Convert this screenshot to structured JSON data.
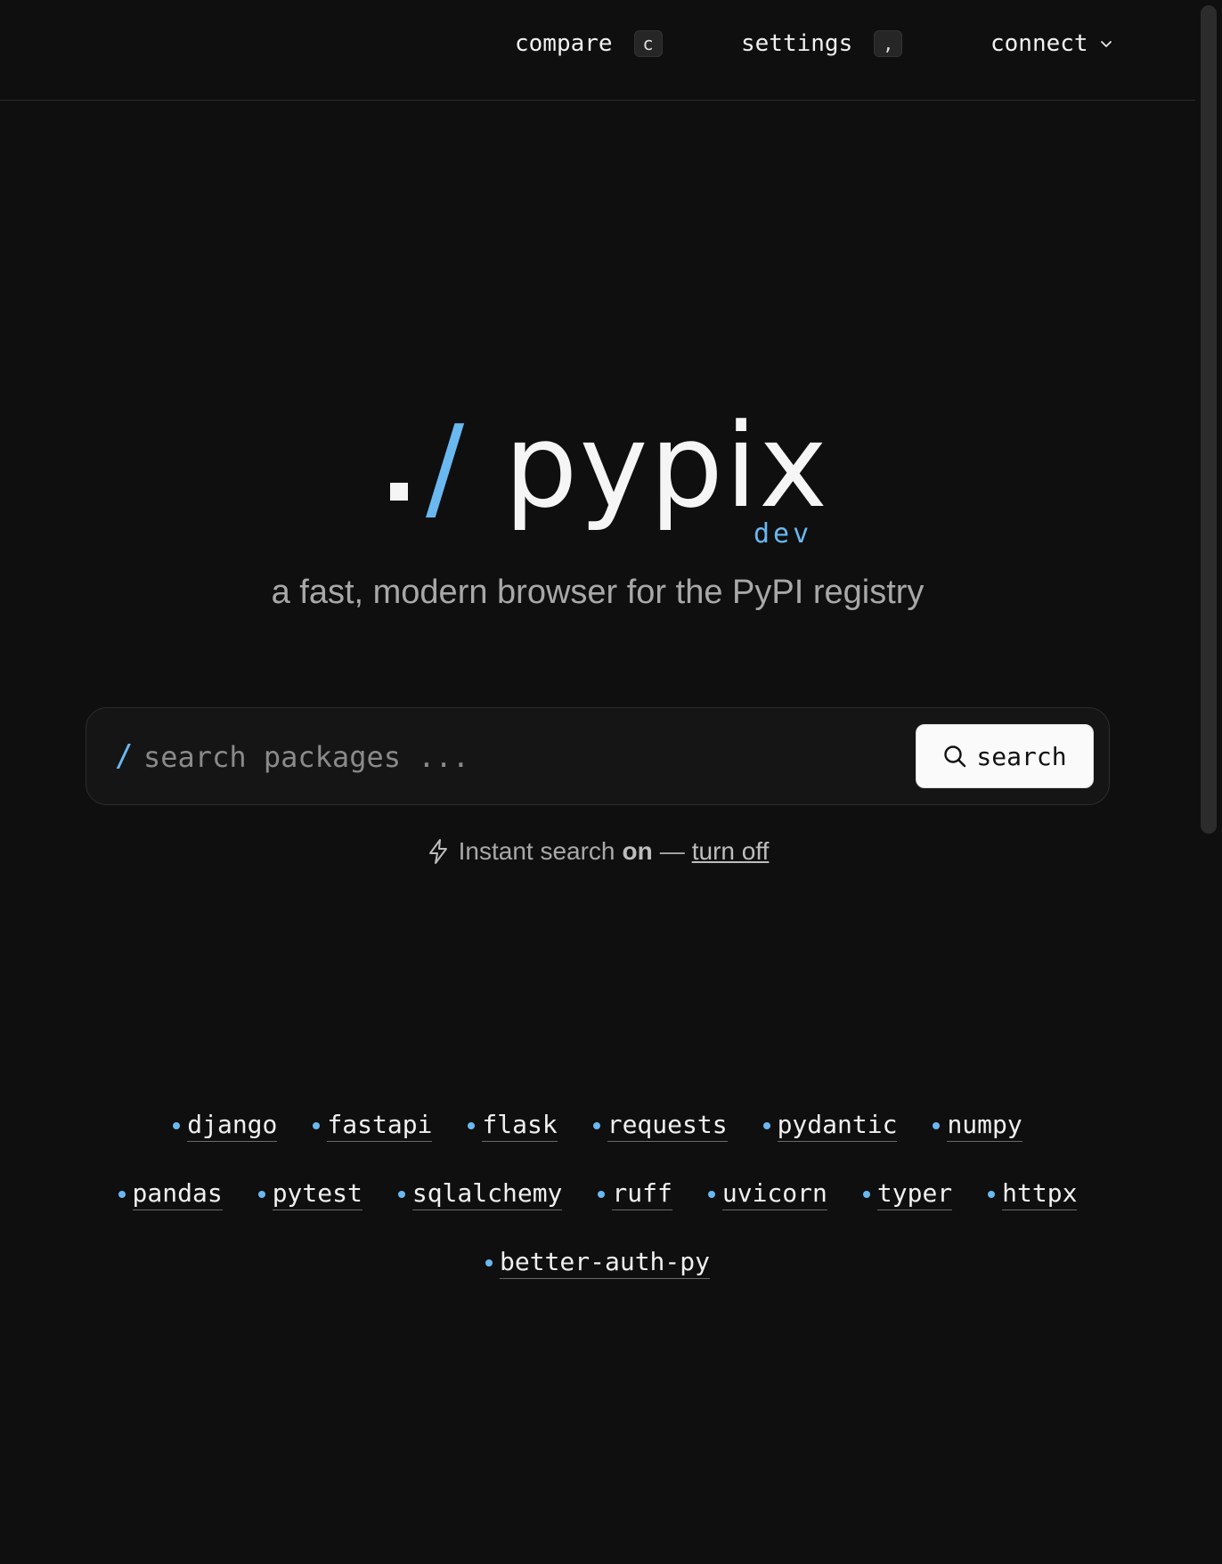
{
  "header": {
    "nav": [
      {
        "label": "compare",
        "shortcut": "c"
      },
      {
        "label": "settings",
        "shortcut": ","
      },
      {
        "label": "connect"
      }
    ]
  },
  "logo": {
    "dot": ".",
    "slash": "/",
    "name": "pypix",
    "tag": "dev"
  },
  "tagline": "a fast, modern browser for the PyPI registry",
  "search": {
    "prefix": "/",
    "placeholder": "search packages ...",
    "button_label": "search"
  },
  "instant": {
    "text": "Instant search",
    "state": "on",
    "dash": "—",
    "toggle_label": "turn off"
  },
  "packages": {
    "row1": [
      "django",
      "fastapi",
      "flask",
      "requests",
      "pydantic",
      "numpy"
    ],
    "row2": [
      "pandas",
      "pytest",
      "sqlalchemy",
      "ruff",
      "uvicorn",
      "typer",
      "httpx"
    ],
    "row3": [
      "better-auth-py"
    ]
  },
  "colors": {
    "accent": "#6ab8f0",
    "background": "#0f0f0f"
  }
}
